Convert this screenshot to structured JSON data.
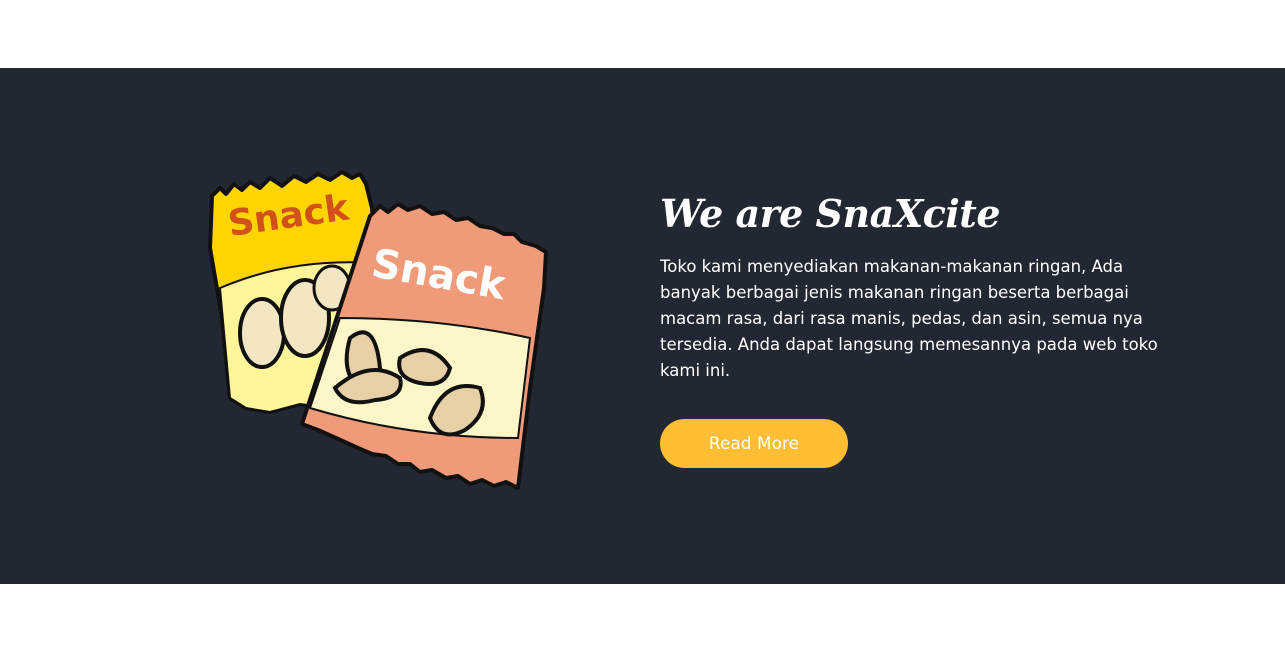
{
  "about": {
    "heading": "We are SnaXcite",
    "description": "Toko kami menyediakan makanan-makanan ringan, Ada banyak berbagai jenis makanan ringan beserta berbagai macam rasa, dari rasa manis, pedas, dan asin, semua nya tersedia. Anda dapat langsung memesannya pada web toko kami ini.",
    "button_label": "Read More",
    "illustration": {
      "icon": "snack-bags-illustration",
      "bag_left_text": "Snack",
      "bag_right_text": "Snack"
    }
  },
  "colors": {
    "section_bg": "#222831",
    "accent": "#ffbe33",
    "text": "#ffffff",
    "bag_yellow": "#ffd400",
    "bag_salmon": "#ee9675",
    "bag_cream": "#fdf6c8"
  }
}
